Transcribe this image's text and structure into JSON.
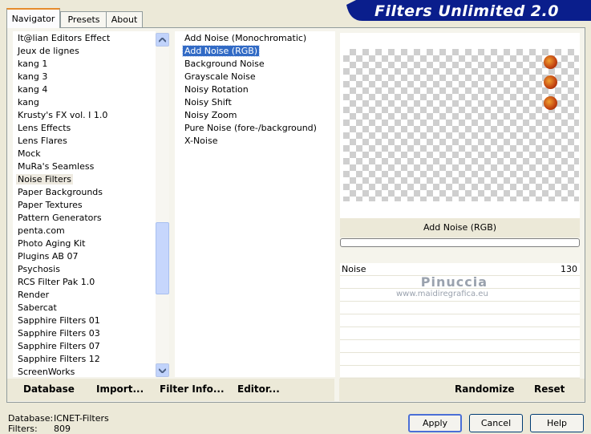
{
  "tabs": [
    "Navigator",
    "Presets",
    "About"
  ],
  "banner_title": "Filters Unlimited 2.0",
  "categories": [
    "It@lian Editors Effect",
    "Jeux de lignes",
    "kang 1",
    "kang 3",
    "kang 4",
    "kang",
    "Krusty's FX vol. I 1.0",
    "Lens Effects",
    "Lens Flares",
    "Mock",
    "MuRa's Seamless",
    "Noise Filters",
    "Paper Backgrounds",
    "Paper Textures",
    "Pattern Generators",
    "penta.com",
    "Photo Aging Kit",
    "Plugins AB 07",
    "Psychosis",
    "RCS Filter Pak 1.0",
    "Render",
    "Sabercat",
    "Sapphire Filters 01",
    "Sapphire Filters 03",
    "Sapphire Filters 07",
    "Sapphire Filters 12",
    "ScreenWorks"
  ],
  "selected_category": "Noise Filters",
  "filters": [
    "Add Noise (Monochromatic)",
    "Add Noise (RGB)",
    "Background Noise",
    "Grayscale Noise",
    "Noisy Rotation",
    "Noisy Shift",
    "Noisy Zoom",
    "Pure Noise (fore-/background)",
    "X-Noise"
  ],
  "selected_filter": "Add Noise (RGB)",
  "bottom_actions": {
    "database": "Database",
    "import": "Import...",
    "filter_info": "Filter Info...",
    "editor": "Editor...",
    "randomize": "Randomize",
    "reset": "Reset"
  },
  "preview_title": "Add Noise (RGB)",
  "parameter": {
    "label": "Noise",
    "value": "130"
  },
  "watermark": {
    "name": "Pinuccia",
    "site": "www.maidiregrafica.eu"
  },
  "status": {
    "database_label": "Database:",
    "database_value": "ICNET-Filters",
    "filters_label": "Filters:",
    "filters_value": "809"
  },
  "dialog_buttons": {
    "apply": "Apply",
    "cancel": "Cancel",
    "help": "Help"
  },
  "colors": {
    "banner": "#0a1e8c",
    "selection": "#316ac5",
    "tab_highlight": "#e68b2c"
  }
}
